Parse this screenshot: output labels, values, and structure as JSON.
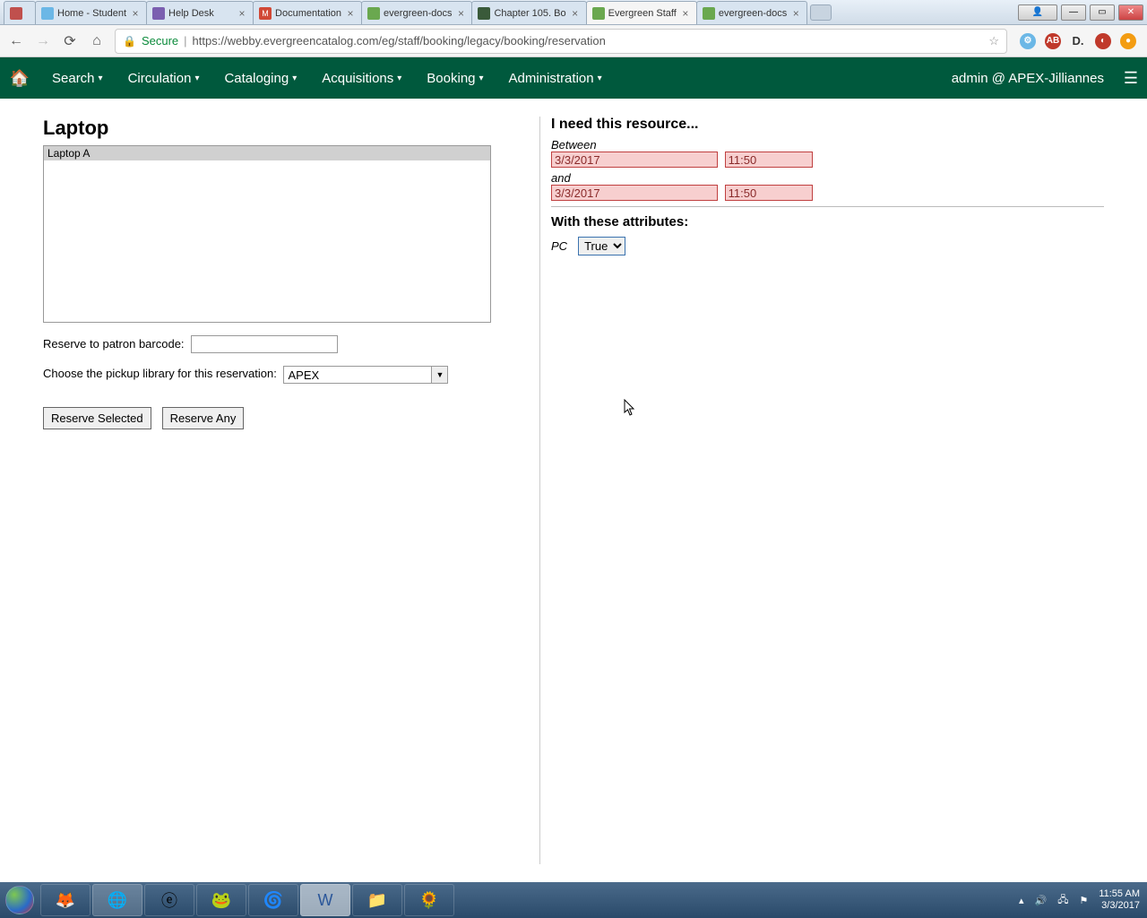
{
  "browser": {
    "tabs": [
      {
        "title": "",
        "favicon_bg": "#c0504d"
      },
      {
        "title": "Home - Student",
        "favicon_bg": "#6bb7e6"
      },
      {
        "title": "Help Desk",
        "favicon_bg": "#7b5fb0"
      },
      {
        "title": "Documentation",
        "favicon_bg": "#d14836"
      },
      {
        "title": "evergreen-docs",
        "favicon_bg": "#6aa84f"
      },
      {
        "title": "Chapter 105. Bo",
        "favicon_bg": "#3a5a3a"
      },
      {
        "title": "Evergreen Staff",
        "favicon_bg": "#6aa84f",
        "active": true
      },
      {
        "title": "evergreen-docs",
        "favicon_bg": "#6aa84f"
      }
    ],
    "secure_label": "Secure",
    "url_host": "https://webby.evergreencatalog.com",
    "url_path": "/eg/staff/booking/legacy/booking/reservation"
  },
  "menubar": {
    "items": [
      "Search",
      "Circulation",
      "Cataloging",
      "Acquisitions",
      "Booking",
      "Administration"
    ],
    "user": "admin @ APEX-Jilliannes"
  },
  "left": {
    "title": "Laptop",
    "list_items": [
      "Laptop A"
    ],
    "barcode_label": "Reserve to patron barcode:",
    "barcode_value": "",
    "pickup_label": "Choose the pickup library for this reservation:",
    "pickup_value": "APEX",
    "btn_reserve_selected": "Reserve Selected",
    "btn_reserve_any": "Reserve Any"
  },
  "right": {
    "need_heading": "I need this resource...",
    "between_label": "Between",
    "and_label": "and",
    "start_date": "3/3/2017",
    "start_time": "11:50",
    "end_date": "3/3/2017",
    "end_time": "11:50",
    "attr_heading": "With these attributes:",
    "attr_pc_label": "PC",
    "attr_pc_value": "True"
  },
  "taskbar": {
    "time": "11:55 AM",
    "date": "3/3/2017"
  }
}
